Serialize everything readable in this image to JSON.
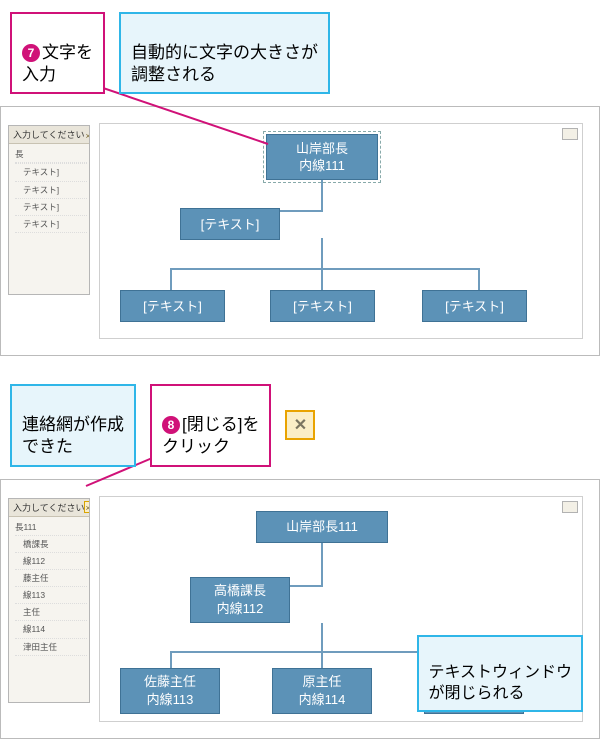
{
  "step7": {
    "badge": "7",
    "callout_magenta": "文字を\n入力",
    "callout_cyan": "自動的に文字の大きさが\n調整される",
    "textpane": {
      "title": "入力してください",
      "items": [
        "長",
        "",
        "テキスト]",
        "テキスト]",
        "テキスト]",
        "テキスト]"
      ]
    },
    "nodes": {
      "root": {
        "line1": "山岸部長",
        "line2": "内線111"
      },
      "child1": {
        "line1": "[テキスト]",
        "line2": ""
      },
      "leaf1": {
        "line1": "[テキスト]",
        "line2": ""
      },
      "leaf2": {
        "line1": "[テキスト]",
        "line2": ""
      },
      "leaf3": {
        "line1": "[テキスト]",
        "line2": ""
      }
    }
  },
  "step8": {
    "badge": "8",
    "callout_cyan_left": "連絡網が作成\nできた",
    "callout_magenta": "[閉じる]を\nクリック",
    "close_icon_label": "✕",
    "textpane": {
      "title": "入力してください",
      "items": [
        "長111",
        "橋課長",
        "線112",
        "藤主任",
        "線113",
        "主任",
        "線114",
        "津田主任"
      ]
    },
    "nodes": {
      "root": {
        "line1": "山岸部長111",
        "line2": ""
      },
      "child1": {
        "line1": "高橋課長",
        "line2": "内線112"
      },
      "leaf1": {
        "line1": "佐藤主任",
        "line2": "内線113"
      },
      "leaf2": {
        "line1": "原主任",
        "line2": "内線114"
      },
      "leaf3": {
        "line1": "",
        "line2": ""
      }
    },
    "overlay_label": "テキストウィンドウ\nが閉じられる"
  }
}
